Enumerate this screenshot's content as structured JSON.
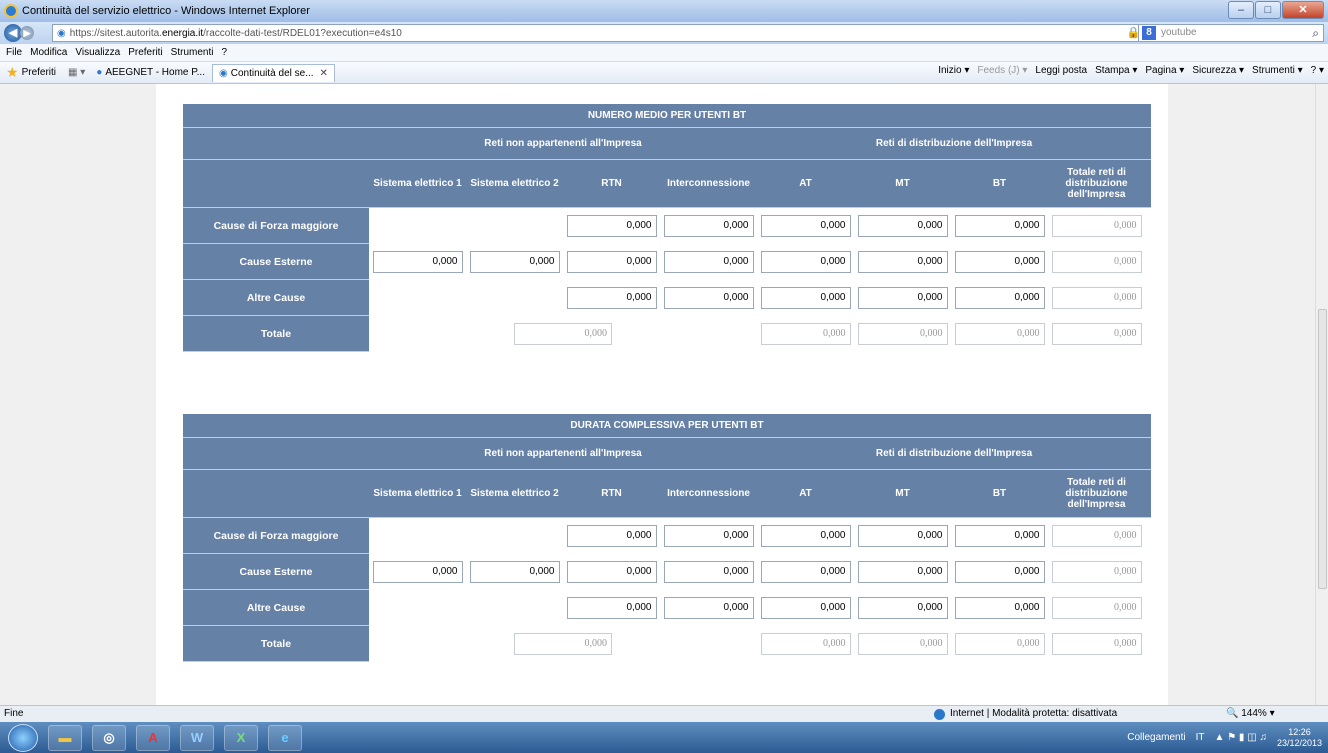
{
  "window": {
    "title": "Continuità del servizio elettrico - Windows Internet Explorer"
  },
  "address": {
    "url_prefix": "https://sitest.autorita.",
    "url_domain": "energia.it",
    "url_suffix": "/raccolte-dati-test/RDEL01?execution=e4s10",
    "search_text": "youtube"
  },
  "menu": [
    "File",
    "Modifica",
    "Visualizza",
    "Preferiti",
    "Strumenti",
    "?"
  ],
  "favorites": {
    "label": "Preferiti",
    "tabs": [
      "AEEGNET - Home P...",
      "Continuità del se..."
    ]
  },
  "commands": [
    "Inizio ▾",
    "Feeds (J) ▾",
    "Leggi posta",
    "Stampa ▾",
    "Pagina ▾",
    "Sicurezza ▾",
    "Strumenti ▾",
    "? ▾"
  ],
  "table_headers": {
    "group_a": "Reti non appartenenti all'Impresa",
    "group_b": "Reti di distribuzione dell'Impresa",
    "columns": [
      "Sistema elettrico 1",
      "Sistema elettrico 2",
      "RTN",
      "Interconnessione",
      "AT",
      "MT",
      "BT",
      "Totale reti di distribuzione dell'Impresa"
    ]
  },
  "tables": [
    {
      "title": "NUMERO MEDIO PER UTENTI BT",
      "rows": [
        {
          "label": "Cause di Forza maggiore",
          "s1": "",
          "s2": "",
          "rtn": "0,000",
          "inter": "0,000",
          "at": "0,000",
          "mt": "0,000",
          "bt": "0,000",
          "tot": "0,000"
        },
        {
          "label": "Cause Esterne",
          "s1": "0,000",
          "s2": "0,000",
          "rtn": "0,000",
          "inter": "0,000",
          "at": "0,000",
          "mt": "0,000",
          "bt": "0,000",
          "tot": "0,000"
        },
        {
          "label": "Altre Cause",
          "s1": "",
          "s2": "",
          "rtn": "0,000",
          "inter": "0,000",
          "at": "0,000",
          "mt": "0,000",
          "bt": "0,000",
          "tot": "0,000"
        },
        {
          "label": "Totale",
          "reti_non_tot": "0,000",
          "at": "0,000",
          "mt": "0,000",
          "bt": "0,000",
          "tot": "0,000"
        }
      ]
    },
    {
      "title": "DURATA COMPLESSIVA PER UTENTI BT",
      "rows": [
        {
          "label": "Cause di Forza maggiore",
          "s1": "",
          "s2": "",
          "rtn": "0,000",
          "inter": "0,000",
          "at": "0,000",
          "mt": "0,000",
          "bt": "0,000",
          "tot": "0,000"
        },
        {
          "label": "Cause Esterne",
          "s1": "0,000",
          "s2": "0,000",
          "rtn": "0,000",
          "inter": "0,000",
          "at": "0,000",
          "mt": "0,000",
          "bt": "0,000",
          "tot": "0,000"
        },
        {
          "label": "Altre Cause",
          "s1": "",
          "s2": "",
          "rtn": "0,000",
          "inter": "0,000",
          "at": "0,000",
          "mt": "0,000",
          "bt": "0,000",
          "tot": "0,000"
        },
        {
          "label": "Totale",
          "reti_non_tot": "0,000",
          "at": "0,000",
          "mt": "0,000",
          "bt": "0,000",
          "tot": "0,000"
        }
      ]
    }
  ],
  "status": {
    "left": "Fine",
    "zone": "Internet | Modalità protetta: disattivata",
    "zoom": "144%"
  },
  "taskbar": {
    "links": "Collegamenti",
    "lang": "IT",
    "time": "12:26",
    "date": "23/12/2013"
  }
}
